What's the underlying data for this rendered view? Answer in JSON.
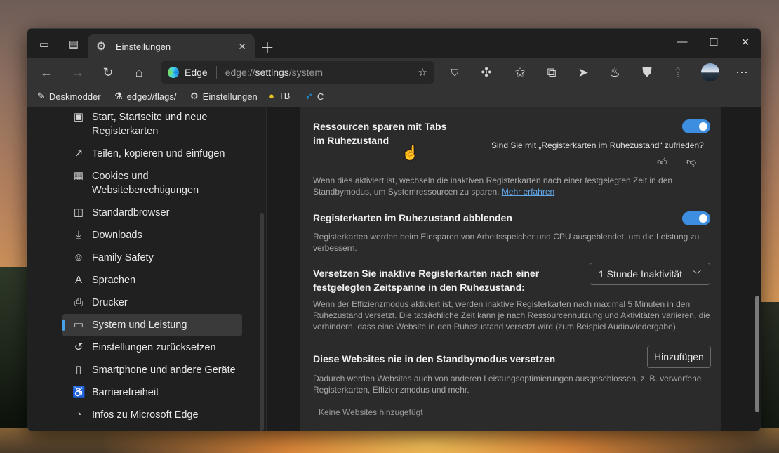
{
  "window": {
    "tab_title": "Einstellungen"
  },
  "toolbar": {
    "address_brand": "Edge",
    "address_prefix": "edge://",
    "address_host": "settings",
    "address_path": "/system"
  },
  "favorites": [
    {
      "label": "Deskmodder",
      "icon": "pen-icon"
    },
    {
      "label": "edge://flags/",
      "icon": "flask-icon"
    },
    {
      "label": "Einstellungen",
      "icon": "gear-icon"
    },
    {
      "label": "TB",
      "icon": "yellow-circle-icon"
    },
    {
      "label": "C",
      "icon": "twitter-bird-icon"
    }
  ],
  "sidebar": {
    "items": [
      {
        "label": "Start, Startseite und neue Registerkarten",
        "icon": "home-tab-icon"
      },
      {
        "label": "Teilen, kopieren und einfügen",
        "icon": "share-icon"
      },
      {
        "label": "Cookies und Websiteberechtigungen",
        "icon": "cookie-icon"
      },
      {
        "label": "Standardbrowser",
        "icon": "browser-icon"
      },
      {
        "label": "Downloads",
        "icon": "download-icon"
      },
      {
        "label": "Family Safety",
        "icon": "family-icon"
      },
      {
        "label": "Sprachen",
        "icon": "language-icon"
      },
      {
        "label": "Drucker",
        "icon": "printer-icon"
      },
      {
        "label": "System und Leistung",
        "icon": "laptop-icon",
        "selected": true
      },
      {
        "label": "Einstellungen zurücksetzen",
        "icon": "reset-icon"
      },
      {
        "label": "Smartphone und andere Geräte",
        "icon": "phone-icon"
      },
      {
        "label": "Barrierefreiheit",
        "icon": "accessibility-icon"
      },
      {
        "label": "Infos zu Microsoft Edge",
        "icon": "edge-icon"
      }
    ]
  },
  "settings": {
    "sleeping_tabs": {
      "title": "Ressourcen sparen mit Tabs im Ruhezustand",
      "enabled": true,
      "feedback_question": "Sind Sie mit „Registerkarten im Ruhezustand“ zufrieden?",
      "description": "Wenn dies aktiviert ist, wechseln die inaktiven Registerkarten nach einer festgelegten Zeit in den Standbymodus, um Systemressourcen zu sparen.",
      "learn_more": "Mehr erfahren"
    },
    "fade_tabs": {
      "title": "Registerkarten im Ruhezustand abblenden",
      "enabled": true,
      "description": "Registerkarten werden beim Einsparen von Arbeitsspeicher und CPU ausgeblendet, um die Leistung zu verbessern."
    },
    "timeout": {
      "title": "Versetzen Sie inaktive Registerkarten nach einer festgelegten Zeitspanne in den Ruhezustand:",
      "selected": "1 Stunde Inaktivität",
      "description": "Wenn der Effizienzmodus aktiviert ist, werden inaktive Registerkarten nach maximal 5 Minuten in den Ruhezustand versetzt. Die tatsächliche Zeit kann je nach Ressourcennutzung und Aktivitäten variieren, die verhindern, dass eine Website in den Ruhezustand versetzt wird (zum Beispiel Audiowiedergabe)."
    },
    "never_sleep": {
      "title": "Diese Websites nie in den Standbymodus versetzen",
      "button": "Hinzufügen",
      "description": "Dadurch werden Websites auch von anderen Leistungsoptimierungen ausgeschlossen, z. B. verworfene Registerkarten, Effizienzmodus und mehr.",
      "empty": "Keine Websites hinzugefügt"
    }
  }
}
